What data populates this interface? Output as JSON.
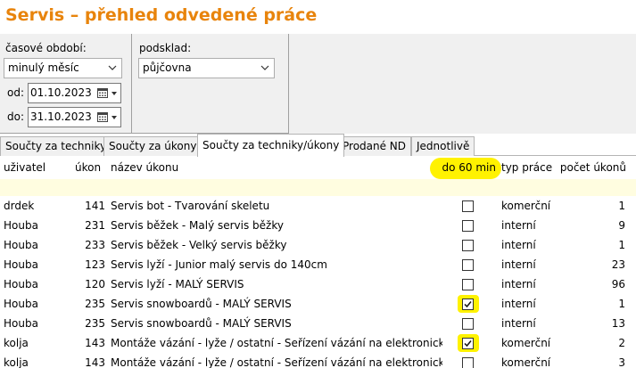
{
  "title": "Servis – přehled odvedené práce",
  "filters": {
    "period_label": "časové období:",
    "period_value": "minulý měsíc",
    "warehouse_label": "podsklad:",
    "warehouse_value": "půjčovna",
    "from_label": "od:",
    "from_value": "01.10.2023",
    "to_label": "do:",
    "to_value": "31.10.2023"
  },
  "tabs": [
    {
      "label": "Součty za techniky",
      "active": false
    },
    {
      "label": "Součty za úkony",
      "active": false
    },
    {
      "label": "Součty za techniky/úkony",
      "active": true
    },
    {
      "label": "Prodané ND",
      "active": false
    },
    {
      "label": "Jednotlivě",
      "active": false
    }
  ],
  "columns": {
    "user": "uživatel",
    "task": "úkon",
    "task_name": "název úkonu",
    "under60": "do 60 min",
    "work_type": "typ práce",
    "count": "počet úkonů"
  },
  "highlight_color": "#fff200",
  "accent_color": "#e8840c",
  "rows": [
    {
      "user": "drdek",
      "task": "141",
      "name": "Servis bot - Tvarování skeletu",
      "under60": false,
      "highlight": false,
      "type": "komerční",
      "count": "1"
    },
    {
      "user": "Houba",
      "task": "231",
      "name": "Servis běžek - Malý servis běžky",
      "under60": false,
      "highlight": false,
      "type": "interní",
      "count": "9"
    },
    {
      "user": "Houba",
      "task": "233",
      "name": "Servis běžek - Velký servis běžky",
      "under60": false,
      "highlight": false,
      "type": "interní",
      "count": "1"
    },
    {
      "user": "Houba",
      "task": "123",
      "name": "Servis lyží - Junior malý servis do 140cm",
      "under60": false,
      "highlight": false,
      "type": "interní",
      "count": "23"
    },
    {
      "user": "Houba",
      "task": "120",
      "name": "Servis lyží - MALÝ SERVIS",
      "under60": false,
      "highlight": false,
      "type": "interní",
      "count": "96"
    },
    {
      "user": "Houba",
      "task": "235",
      "name": "Servis snowboardů - MALÝ SERVIS",
      "under60": true,
      "highlight": true,
      "type": "interní",
      "count": "1"
    },
    {
      "user": "Houba",
      "task": "235",
      "name": "Servis snowboardů - MALÝ SERVIS",
      "under60": false,
      "highlight": false,
      "type": "interní",
      "count": "13"
    },
    {
      "user": "kolja",
      "task": "143",
      "name": "Montáže vázání - lyže / ostatní - Seřízení vázání na elektronické",
      "under60": true,
      "highlight": true,
      "type": "komerční",
      "count": "2"
    },
    {
      "user": "kolja",
      "task": "143",
      "name": "Montáže vázání - lyže / ostatní - Seřízení vázání na elektronické",
      "under60": false,
      "highlight": false,
      "type": "komerční",
      "count": "3"
    }
  ]
}
